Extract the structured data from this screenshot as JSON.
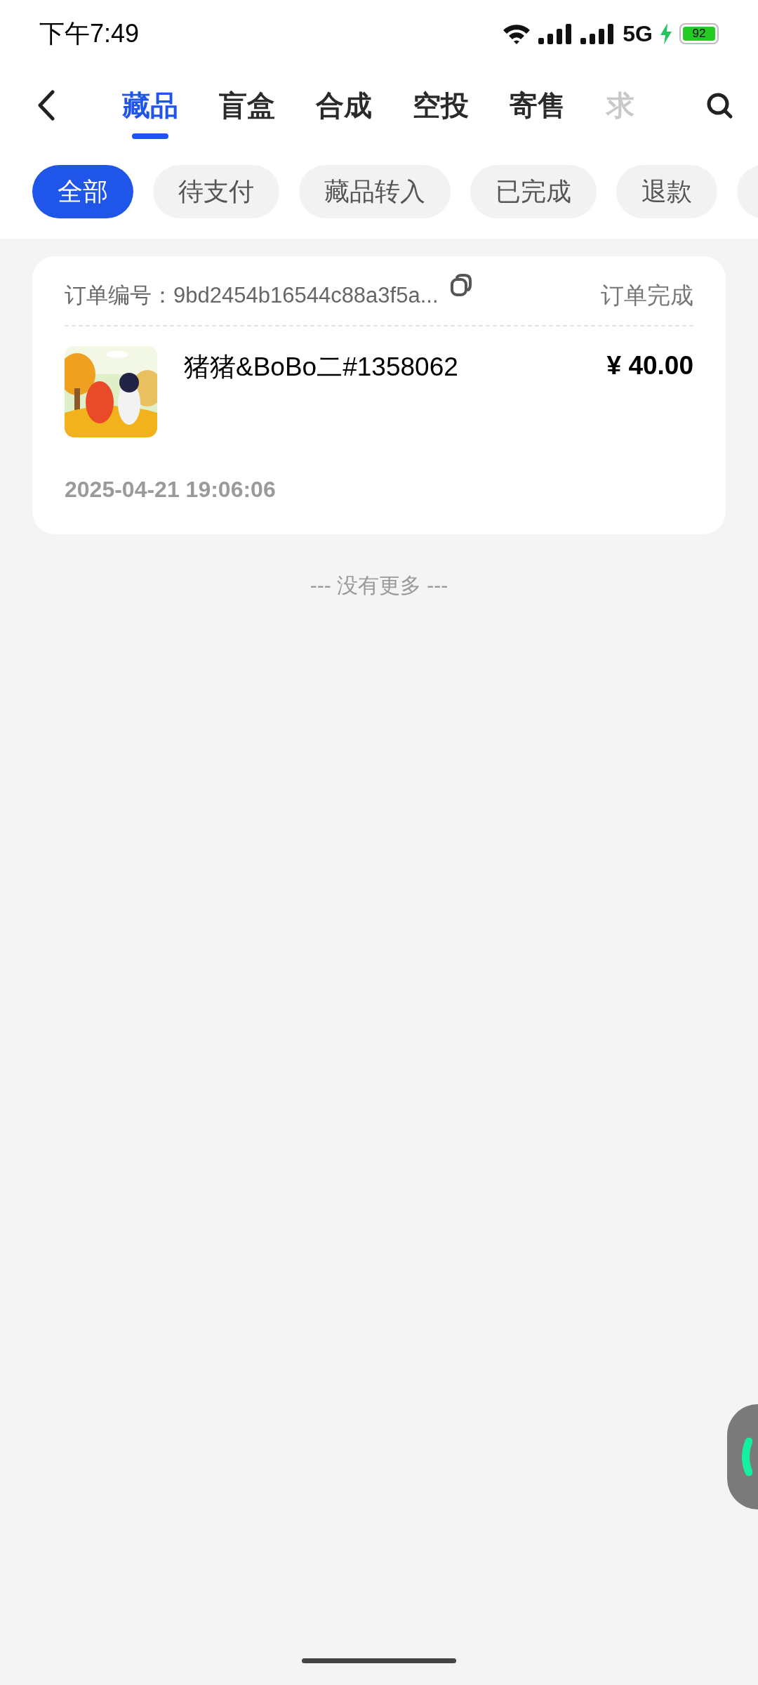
{
  "status_bar": {
    "time": "下午7:49",
    "network": "5G",
    "battery": "92"
  },
  "tabs": [
    {
      "label": "藏品",
      "selected": true
    },
    {
      "label": "盲盒",
      "selected": false
    },
    {
      "label": "合成",
      "selected": false
    },
    {
      "label": "空投",
      "selected": false
    },
    {
      "label": "寄售",
      "selected": false
    },
    {
      "label": "求",
      "selected": false
    }
  ],
  "filters": [
    {
      "label": "全部",
      "selected": true
    },
    {
      "label": "待支付",
      "selected": false
    },
    {
      "label": "藏品转入",
      "selected": false
    },
    {
      "label": "已完成",
      "selected": false
    },
    {
      "label": "退款",
      "selected": false
    }
  ],
  "orders": [
    {
      "number_label": "订单编号：",
      "number": "9bd2454b16544c88a3f5a...",
      "status": "订单完成",
      "title": "猪猪&BoBo二#1358062",
      "price": "¥ 40.00",
      "time": "2025-04-21 19:06:06"
    }
  ],
  "end_text": "--- 没有更多 ---"
}
